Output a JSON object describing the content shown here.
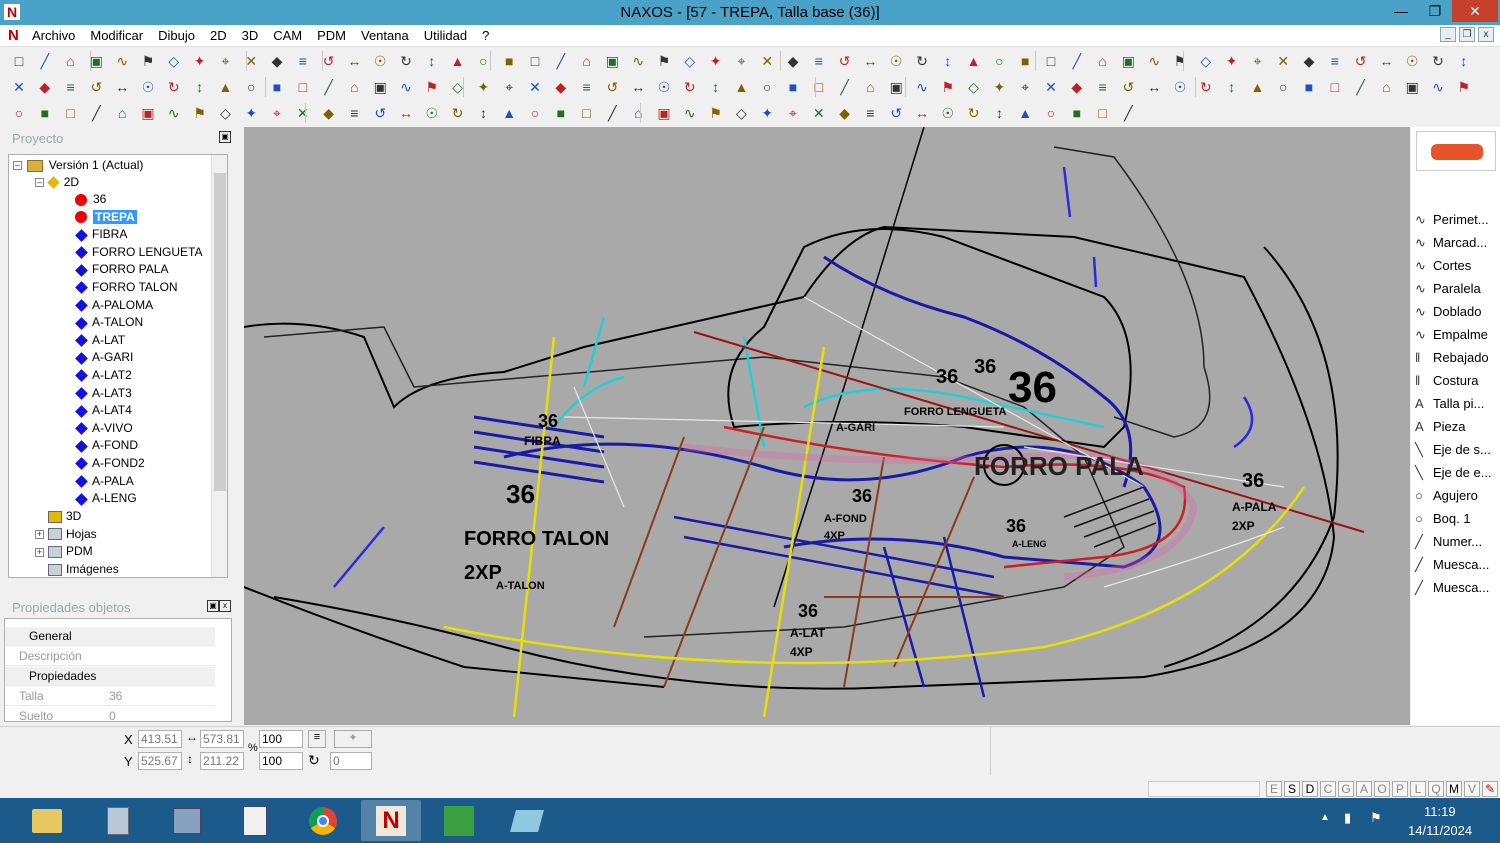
{
  "window": {
    "title": "NAXOS - [57 - TREPA, Talla base (36)]",
    "app_icon": "N"
  },
  "menu": [
    "Archivo",
    "Modificar",
    "Dibujo",
    "2D",
    "3D",
    "CAM",
    "PDM",
    "Ventana",
    "Utilidad",
    "?"
  ],
  "project_panel": {
    "title": "Proyecto",
    "tree": {
      "version": "Versión 1 (Actual)",
      "group_2d": "2D",
      "pieces": [
        {
          "label": "36",
          "marker": "red-dot",
          "selected": false
        },
        {
          "label": "TREPA",
          "marker": "red-dot",
          "selected": true
        },
        {
          "label": "FIBRA",
          "marker": "blue-diamond",
          "selected": false
        },
        {
          "label": "FORRO LENGUETA",
          "marker": "blue-diamond",
          "selected": false
        },
        {
          "label": "FORRO PALA",
          "marker": "blue-diamond",
          "selected": false
        },
        {
          "label": "FORRO TALON",
          "marker": "blue-diamond",
          "selected": false
        },
        {
          "label": "A-PALOMA",
          "marker": "blue-diamond",
          "selected": false
        },
        {
          "label": "A-TALON",
          "marker": "blue-diamond",
          "selected": false
        },
        {
          "label": "A-LAT",
          "marker": "blue-diamond",
          "selected": false
        },
        {
          "label": "A-GARI",
          "marker": "blue-diamond",
          "selected": false
        },
        {
          "label": "A-LAT2",
          "marker": "blue-diamond",
          "selected": false
        },
        {
          "label": "A-LAT3",
          "marker": "blue-diamond",
          "selected": false
        },
        {
          "label": "A-LAT4",
          "marker": "blue-diamond",
          "selected": false
        },
        {
          "label": "A-VIVO",
          "marker": "blue-diamond",
          "selected": false
        },
        {
          "label": "A-FOND",
          "marker": "blue-diamond",
          "selected": false
        },
        {
          "label": "A-FOND2",
          "marker": "blue-diamond",
          "selected": false
        },
        {
          "label": "A-PALA",
          "marker": "blue-diamond",
          "selected": false
        },
        {
          "label": "A-LENG",
          "marker": "blue-diamond",
          "selected": false
        }
      ],
      "others": [
        "3D",
        "Hojas",
        "PDM",
        "Imágenes"
      ]
    }
  },
  "properties_panel": {
    "title": "Propiedades objetos",
    "groups": [
      {
        "name": "General",
        "rows": [
          {
            "key": "Descripción",
            "value": ""
          }
        ]
      },
      {
        "name": "Propiedades",
        "rows": [
          {
            "key": "Talla",
            "value": "36"
          },
          {
            "key": "Suelto",
            "value": "0"
          }
        ]
      }
    ]
  },
  "canvas_labels": {
    "big_36": "36",
    "forro_pala": "FORRO PALA",
    "forro_talon": "FORRO TALON",
    "forro_lengueta": "FORRO LENGUETA",
    "fibra": "FIBRA",
    "a_gari": "A-GARI",
    "a_fond": "A-FOND",
    "a_lat": "A-LAT",
    "a_pala": "A-PALA",
    "a_talon": "A-TALON",
    "a_leng": "A-LENG",
    "n36": "36",
    "x2": "2XP",
    "x4": "4XP"
  },
  "tool_panel": {
    "items": [
      {
        "icon": "perimeter-icon",
        "label": "Perimet..."
      },
      {
        "icon": "mark-icon",
        "label": "Marcad..."
      },
      {
        "icon": "cut-icon",
        "label": "Cortes"
      },
      {
        "icon": "parallel-icon",
        "label": "Paralela"
      },
      {
        "icon": "fold-icon",
        "label": "Doblado"
      },
      {
        "icon": "join-icon",
        "label": "Empalme"
      },
      {
        "icon": "skive-icon",
        "label": "Rebajado"
      },
      {
        "icon": "seam-icon",
        "label": "Costura"
      },
      {
        "icon": "text-icon",
        "label": "Talla pi..."
      },
      {
        "icon": "text-icon",
        "label": "Pieza"
      },
      {
        "icon": "axis-icon",
        "label": "Eje de s..."
      },
      {
        "icon": "axis-icon",
        "label": "Eje de e..."
      },
      {
        "icon": "hole-icon",
        "label": "Agujero"
      },
      {
        "icon": "hole-icon",
        "label": "Boq. 1"
      },
      {
        "icon": "number-icon",
        "label": "Numer..."
      },
      {
        "icon": "notch-icon",
        "label": "Muesca..."
      },
      {
        "icon": "notch-icon",
        "label": "Muesca..."
      }
    ]
  },
  "coords": {
    "x_label": "X",
    "y_label": "Y",
    "x": "413.51",
    "y": "525.67",
    "w": "573.81",
    "h": "211.22",
    "percent": "%",
    "scale_x": "100",
    "scale_y": "100",
    "rotation": "0"
  },
  "status_keys": [
    "E",
    "S",
    "D",
    "C",
    "G",
    "A",
    "O",
    "P",
    "L",
    "Q",
    "M",
    "V"
  ],
  "taskbar": {
    "time": "11:19",
    "date": "14/11/2024"
  },
  "colors": {
    "titlebar": "#4aa2c8",
    "taskbar": "#1c5a8b",
    "selection": "#3399ff",
    "canvas": "#a9a9a9"
  }
}
